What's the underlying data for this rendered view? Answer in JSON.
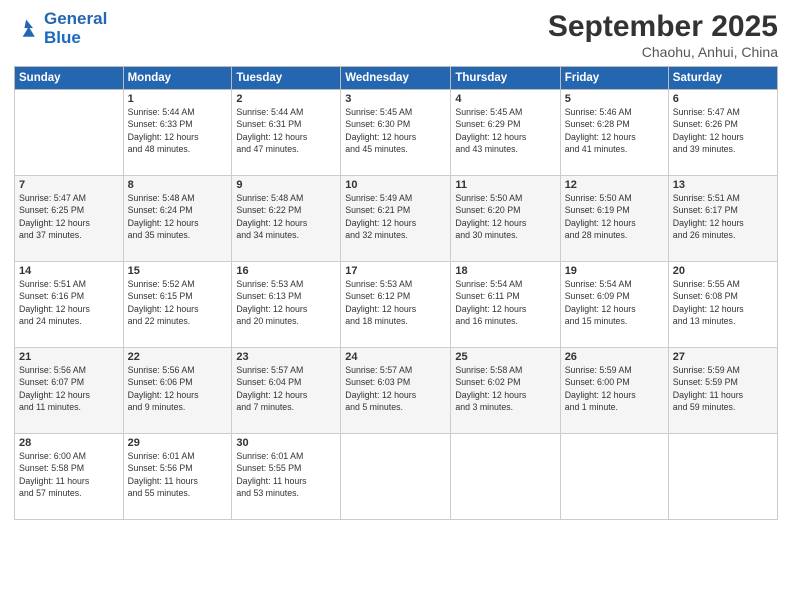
{
  "logo": {
    "line1": "General",
    "line2": "Blue"
  },
  "title": "September 2025",
  "subtitle": "Chaohu, Anhui, China",
  "weekdays": [
    "Sunday",
    "Monday",
    "Tuesday",
    "Wednesday",
    "Thursday",
    "Friday",
    "Saturday"
  ],
  "weeks": [
    [
      {
        "day": "",
        "text": ""
      },
      {
        "day": "1",
        "text": "Sunrise: 5:44 AM\nSunset: 6:33 PM\nDaylight: 12 hours\nand 48 minutes."
      },
      {
        "day": "2",
        "text": "Sunrise: 5:44 AM\nSunset: 6:31 PM\nDaylight: 12 hours\nand 47 minutes."
      },
      {
        "day": "3",
        "text": "Sunrise: 5:45 AM\nSunset: 6:30 PM\nDaylight: 12 hours\nand 45 minutes."
      },
      {
        "day": "4",
        "text": "Sunrise: 5:45 AM\nSunset: 6:29 PM\nDaylight: 12 hours\nand 43 minutes."
      },
      {
        "day": "5",
        "text": "Sunrise: 5:46 AM\nSunset: 6:28 PM\nDaylight: 12 hours\nand 41 minutes."
      },
      {
        "day": "6",
        "text": "Sunrise: 5:47 AM\nSunset: 6:26 PM\nDaylight: 12 hours\nand 39 minutes."
      }
    ],
    [
      {
        "day": "7",
        "text": "Sunrise: 5:47 AM\nSunset: 6:25 PM\nDaylight: 12 hours\nand 37 minutes."
      },
      {
        "day": "8",
        "text": "Sunrise: 5:48 AM\nSunset: 6:24 PM\nDaylight: 12 hours\nand 35 minutes."
      },
      {
        "day": "9",
        "text": "Sunrise: 5:48 AM\nSunset: 6:22 PM\nDaylight: 12 hours\nand 34 minutes."
      },
      {
        "day": "10",
        "text": "Sunrise: 5:49 AM\nSunset: 6:21 PM\nDaylight: 12 hours\nand 32 minutes."
      },
      {
        "day": "11",
        "text": "Sunrise: 5:50 AM\nSunset: 6:20 PM\nDaylight: 12 hours\nand 30 minutes."
      },
      {
        "day": "12",
        "text": "Sunrise: 5:50 AM\nSunset: 6:19 PM\nDaylight: 12 hours\nand 28 minutes."
      },
      {
        "day": "13",
        "text": "Sunrise: 5:51 AM\nSunset: 6:17 PM\nDaylight: 12 hours\nand 26 minutes."
      }
    ],
    [
      {
        "day": "14",
        "text": "Sunrise: 5:51 AM\nSunset: 6:16 PM\nDaylight: 12 hours\nand 24 minutes."
      },
      {
        "day": "15",
        "text": "Sunrise: 5:52 AM\nSunset: 6:15 PM\nDaylight: 12 hours\nand 22 minutes."
      },
      {
        "day": "16",
        "text": "Sunrise: 5:53 AM\nSunset: 6:13 PM\nDaylight: 12 hours\nand 20 minutes."
      },
      {
        "day": "17",
        "text": "Sunrise: 5:53 AM\nSunset: 6:12 PM\nDaylight: 12 hours\nand 18 minutes."
      },
      {
        "day": "18",
        "text": "Sunrise: 5:54 AM\nSunset: 6:11 PM\nDaylight: 12 hours\nand 16 minutes."
      },
      {
        "day": "19",
        "text": "Sunrise: 5:54 AM\nSunset: 6:09 PM\nDaylight: 12 hours\nand 15 minutes."
      },
      {
        "day": "20",
        "text": "Sunrise: 5:55 AM\nSunset: 6:08 PM\nDaylight: 12 hours\nand 13 minutes."
      }
    ],
    [
      {
        "day": "21",
        "text": "Sunrise: 5:56 AM\nSunset: 6:07 PM\nDaylight: 12 hours\nand 11 minutes."
      },
      {
        "day": "22",
        "text": "Sunrise: 5:56 AM\nSunset: 6:06 PM\nDaylight: 12 hours\nand 9 minutes."
      },
      {
        "day": "23",
        "text": "Sunrise: 5:57 AM\nSunset: 6:04 PM\nDaylight: 12 hours\nand 7 minutes."
      },
      {
        "day": "24",
        "text": "Sunrise: 5:57 AM\nSunset: 6:03 PM\nDaylight: 12 hours\nand 5 minutes."
      },
      {
        "day": "25",
        "text": "Sunrise: 5:58 AM\nSunset: 6:02 PM\nDaylight: 12 hours\nand 3 minutes."
      },
      {
        "day": "26",
        "text": "Sunrise: 5:59 AM\nSunset: 6:00 PM\nDaylight: 12 hours\nand 1 minute."
      },
      {
        "day": "27",
        "text": "Sunrise: 5:59 AM\nSunset: 5:59 PM\nDaylight: 11 hours\nand 59 minutes."
      }
    ],
    [
      {
        "day": "28",
        "text": "Sunrise: 6:00 AM\nSunset: 5:58 PM\nDaylight: 11 hours\nand 57 minutes."
      },
      {
        "day": "29",
        "text": "Sunrise: 6:01 AM\nSunset: 5:56 PM\nDaylight: 11 hours\nand 55 minutes."
      },
      {
        "day": "30",
        "text": "Sunrise: 6:01 AM\nSunset: 5:55 PM\nDaylight: 11 hours\nand 53 minutes."
      },
      {
        "day": "",
        "text": ""
      },
      {
        "day": "",
        "text": ""
      },
      {
        "day": "",
        "text": ""
      },
      {
        "day": "",
        "text": ""
      }
    ]
  ]
}
